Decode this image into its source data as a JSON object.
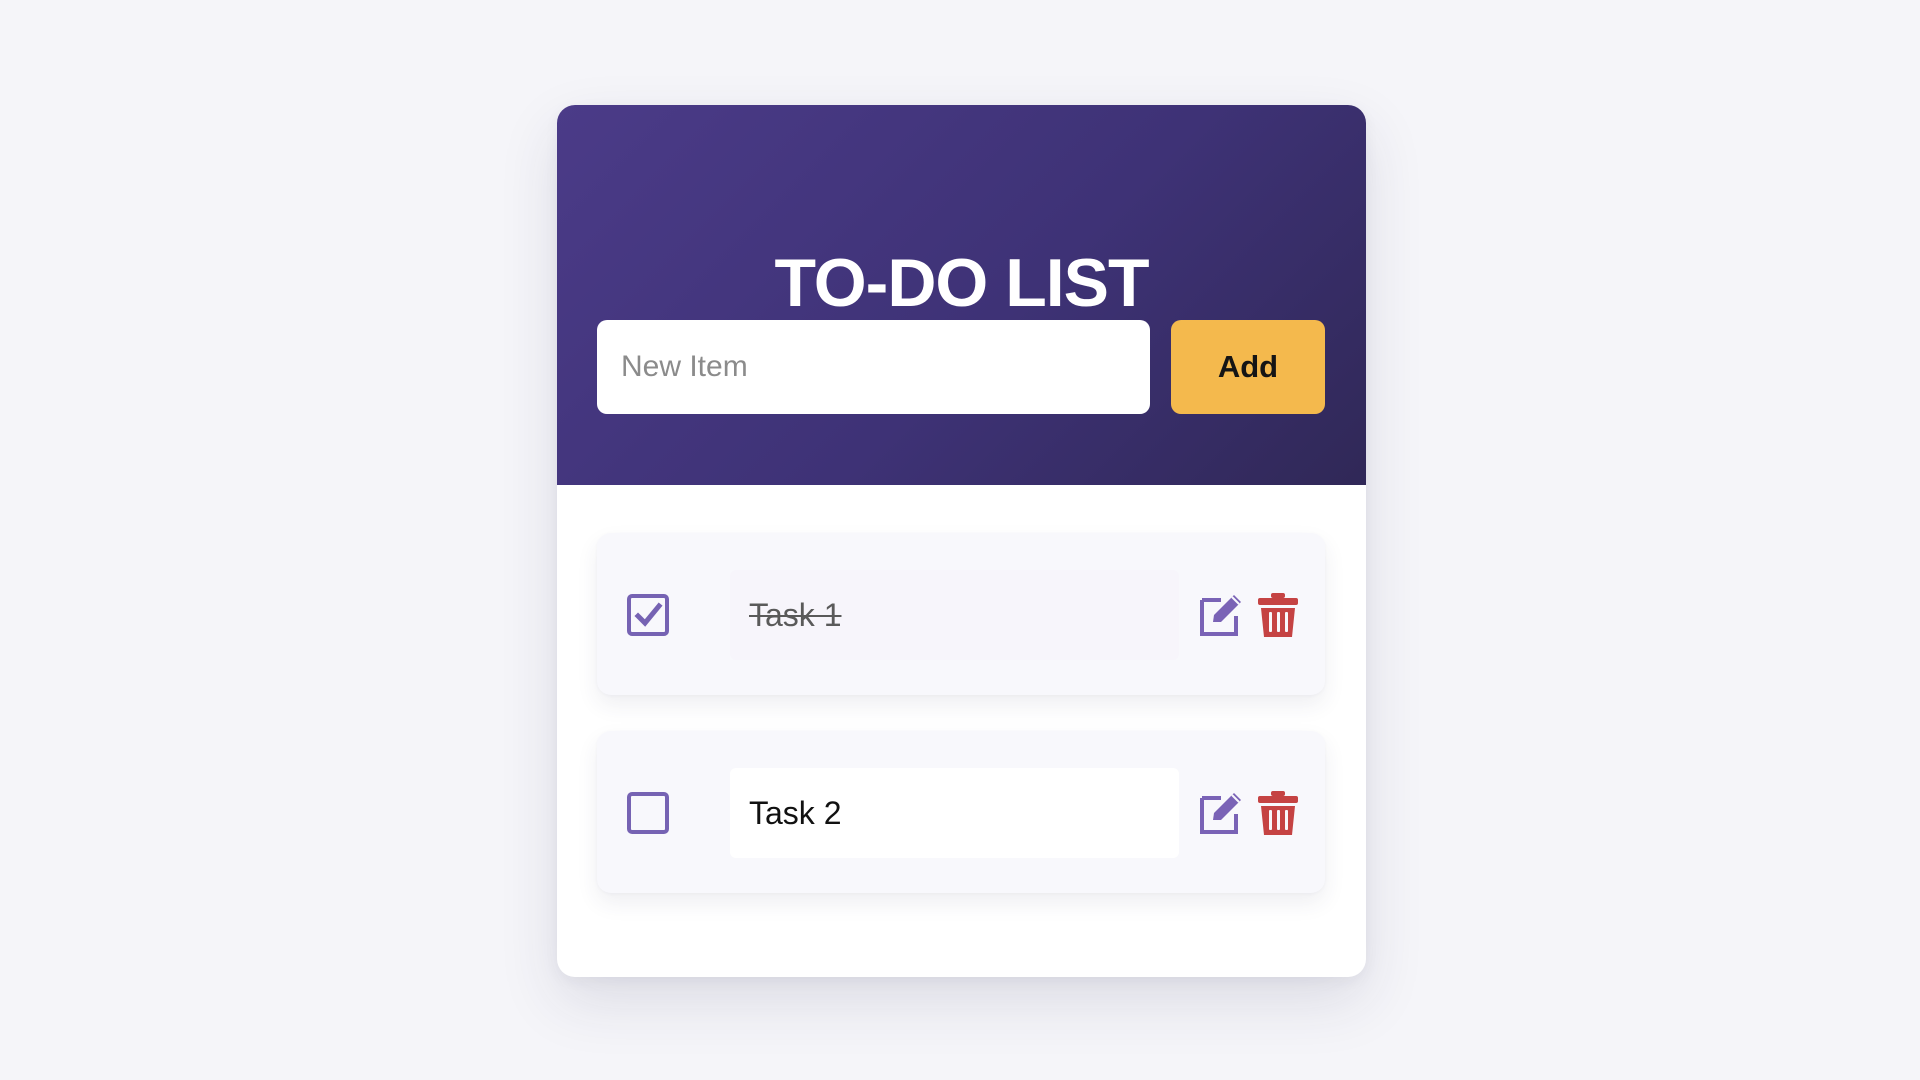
{
  "page": {
    "title": "TO-DO LIST",
    "background_color": "#f5f5f9"
  },
  "header": {
    "title": "TO-DO LIST",
    "background_start": "#4b3b88",
    "background_end": "#302857"
  },
  "new_item": {
    "value": "",
    "placeholder": "New Item"
  },
  "add_button": {
    "label": "Add",
    "color": "#f4b94d"
  },
  "todo_items": [
    {
      "text": "Task 1",
      "checked": true,
      "strikethrough": true,
      "edit_icon": "edit-icon",
      "delete_icon": "trash-icon"
    },
    {
      "text": "Task 2",
      "checked": false,
      "strikethrough": false,
      "edit_icon": "edit-icon",
      "delete_icon": "trash-icon"
    }
  ],
  "colors": {
    "checkbox": "#7663b3",
    "edit_icon": "#7a63b6",
    "delete_icon": "#c54343"
  }
}
